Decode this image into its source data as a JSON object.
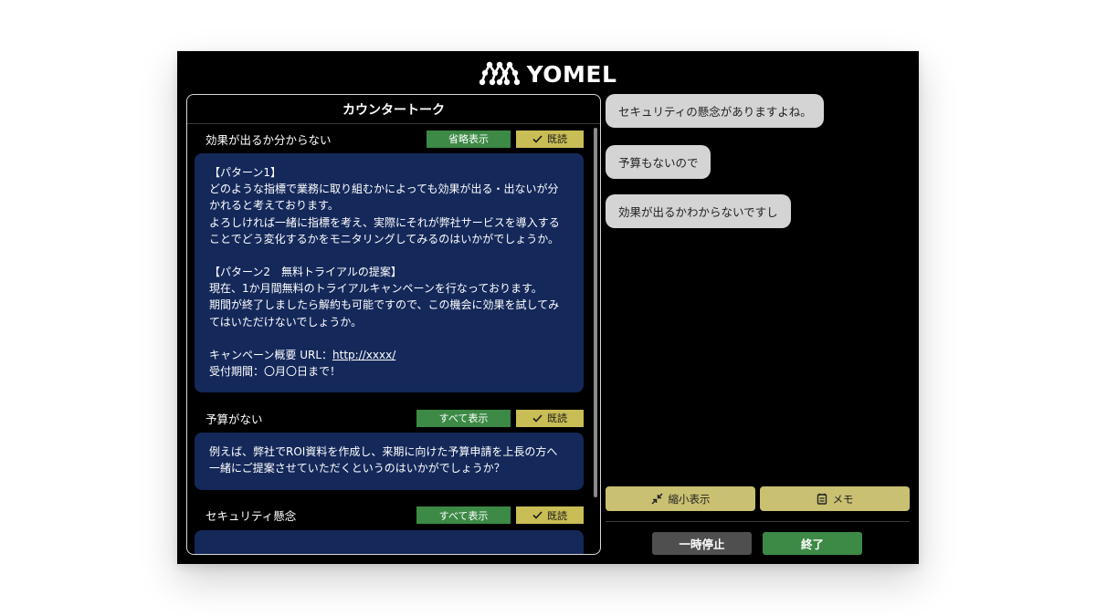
{
  "app": {
    "logo_text": "YOMEL"
  },
  "left_panel": {
    "title": "カウンタートーク",
    "sections": [
      {
        "title": "効果が出るか分からない",
        "toggle_label": "省略表示",
        "read_label": "既読",
        "lines": [
          "【パターン1】",
          "どのような指標で業務に取り組むかによっても効果が出る・出ないが分",
          "かれると考えております。",
          "よろしければ一緒に指標を考え、実際にそれが弊社サービスを導入する",
          "ことでどう変化するかをモニタリングしてみるのはいかがでしょうか。",
          "",
          "【パターン2　無料トライアルの提案】",
          "現在、1か月間無料のトライアルキャンペーンを行なっております。",
          "期間が終了しましたら解約も可能ですので、この機会に効果を試してみ",
          "てはいただけないでしょうか。",
          "",
          "受付期間：〇月〇日まで！"
        ],
        "url_prefix": "キャンペーン概要 URL：",
        "url": "http://xxxx/"
      },
      {
        "title": "予算がない",
        "toggle_label": "すべて表示",
        "read_label": "既読",
        "lines": [
          "例えば、弊社でROI資料を作成し、来期に向けた予算申請を上長の方へ",
          "一緒にご提案させていただくというのはいかがでしょうか？"
        ]
      },
      {
        "title": "セキュリティ懸念",
        "toggle_label": "すべて表示",
        "read_label": "既読"
      }
    ]
  },
  "chat": {
    "bubbles": [
      "セキュリティの懸念がありますよね。",
      "予算もないので",
      "効果が出るかわからないですし"
    ]
  },
  "toolbar": {
    "shrink_label": "縮小表示",
    "memo_label": "メモ",
    "pause_label": "一時停止",
    "end_label": "終了"
  },
  "colors": {
    "answer_card": "#14285a",
    "green_button": "#3c8a45",
    "read_button": "#c9bd55",
    "tool_button": "#c9c071",
    "bubble": "#d4d4d4"
  },
  "icons": {
    "logo": "people-cluster-icon",
    "read": "check-icon",
    "shrink": "shrink-arrows-icon",
    "memo": "memo-icon"
  }
}
